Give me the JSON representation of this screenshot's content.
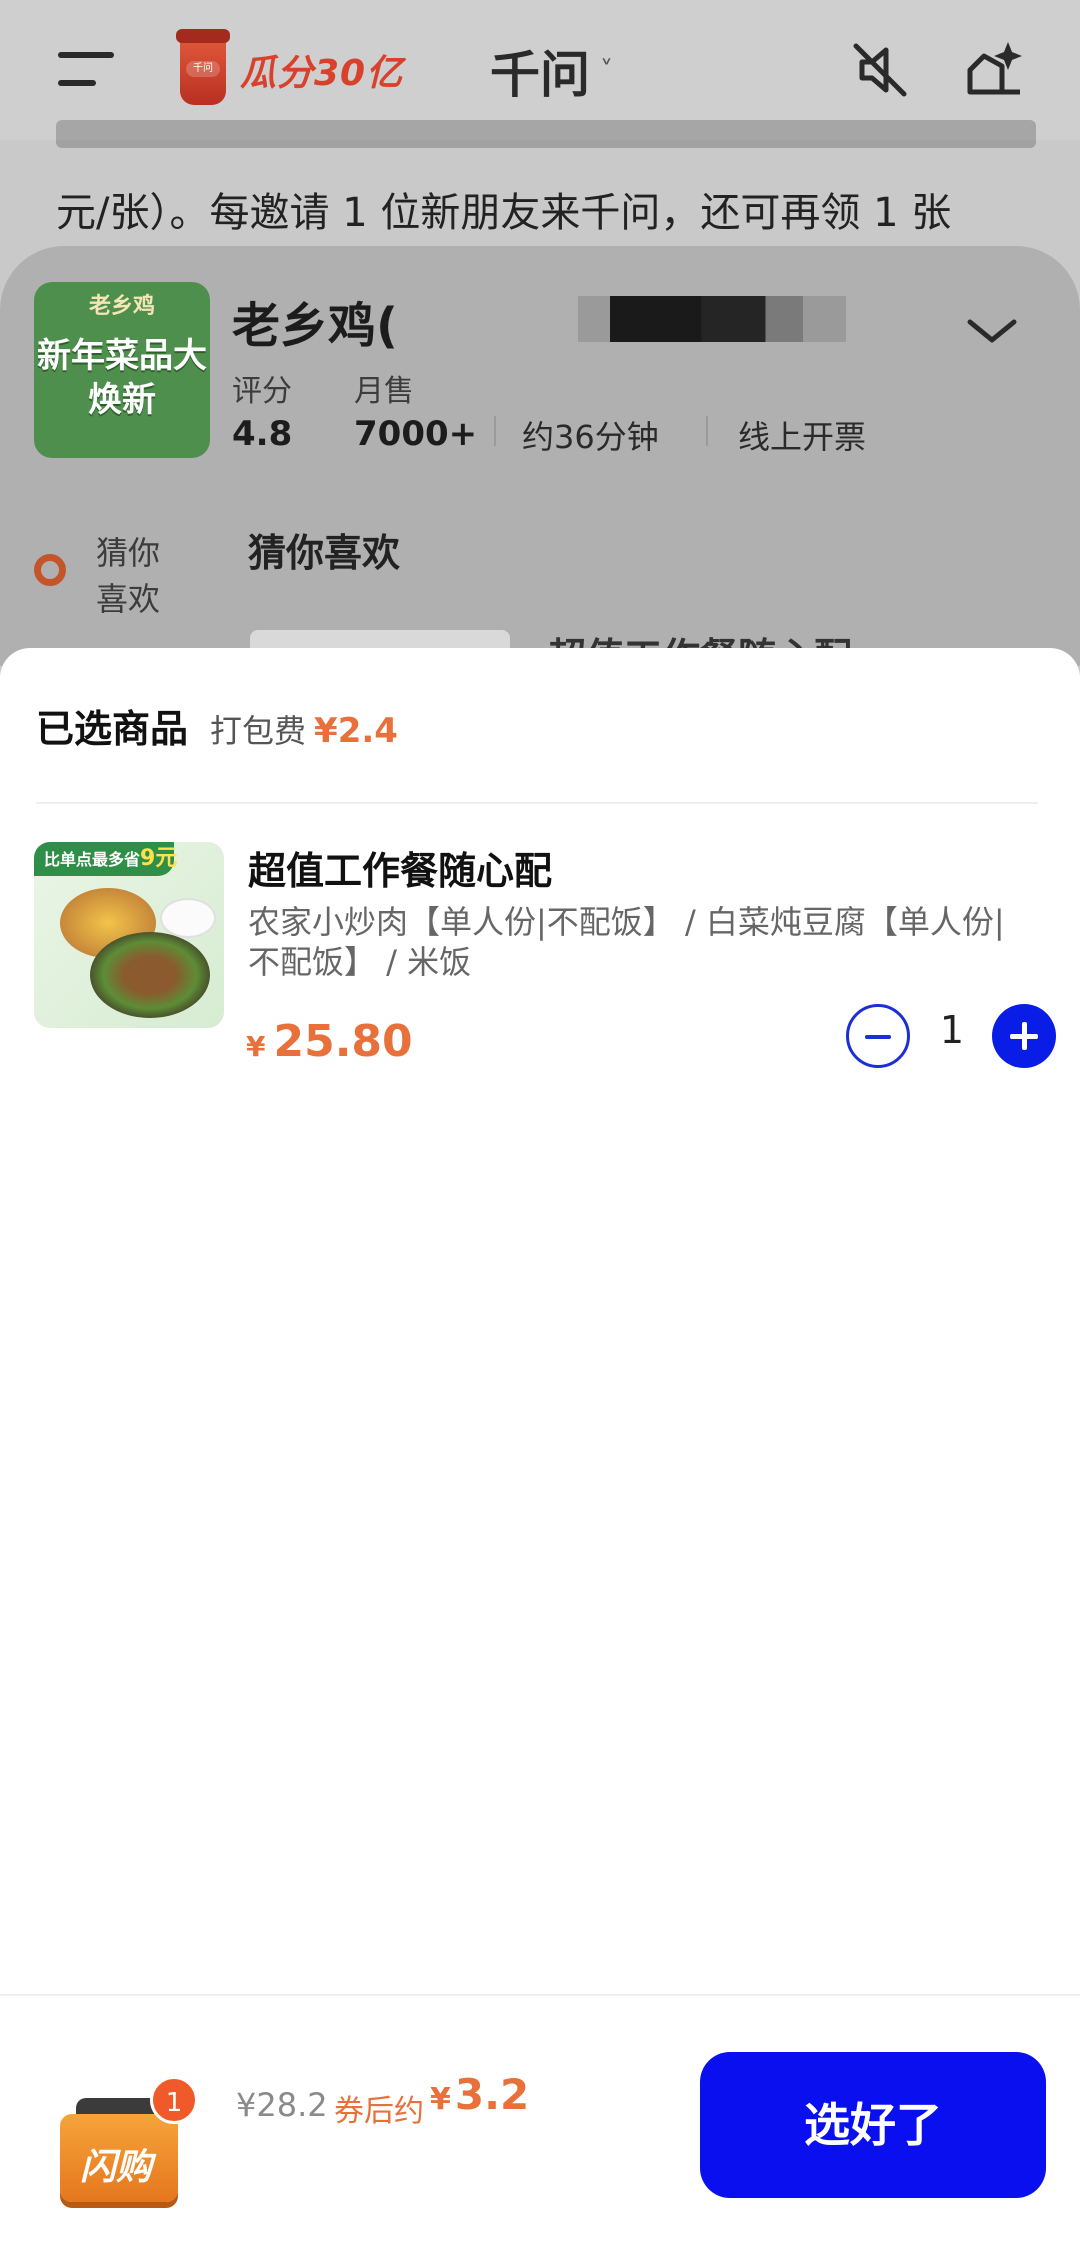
{
  "header": {
    "promo_text": "瓜分30亿",
    "promo_cup_badge": "千问",
    "app_title": "千问",
    "title_chevron": "˅"
  },
  "chat": {
    "visible_line": "元/张）。每邀请 1 位新朋友来千问，还可再领 1 张"
  },
  "store": {
    "logo_top_text": "老乡鸡",
    "logo_main_text": "新年菜品大焕新",
    "name": "老乡鸡(",
    "rating_label": "评分",
    "rating_value": "4.8",
    "sales_label": "月售",
    "sales_value": "7000+",
    "delivery_time": "约36分钟",
    "invoice": "线上开票",
    "side_nav_label": "猜你喜欢",
    "section_title": "猜你喜欢",
    "peek_text": "超值工作餐随心配"
  },
  "cart": {
    "title": "已选商品",
    "packing_fee_label": "打包费",
    "packing_fee": "¥2.4",
    "items": [
      {
        "image_badge_prefix": "比单点最多省",
        "image_badge_amount": "9元",
        "name": "超值工作餐随心配",
        "description": "农家小炒肉【单人份|不配饭】 / 白菜炖豆腐【单人份|不配饭】 / 米饭",
        "price_currency": "¥",
        "price": "25.80",
        "quantity": "1"
      }
    ]
  },
  "checkout": {
    "bag_label": "闪购",
    "bag_count": "1",
    "original_price": "¥28.2",
    "after_coupon_label": "券后约",
    "after_coupon_currency": "¥",
    "after_coupon_price": "3.2",
    "confirm_label": "选好了"
  },
  "colors": {
    "accent_blue": "#0a0ff0",
    "price_orange": "#e8703a"
  }
}
